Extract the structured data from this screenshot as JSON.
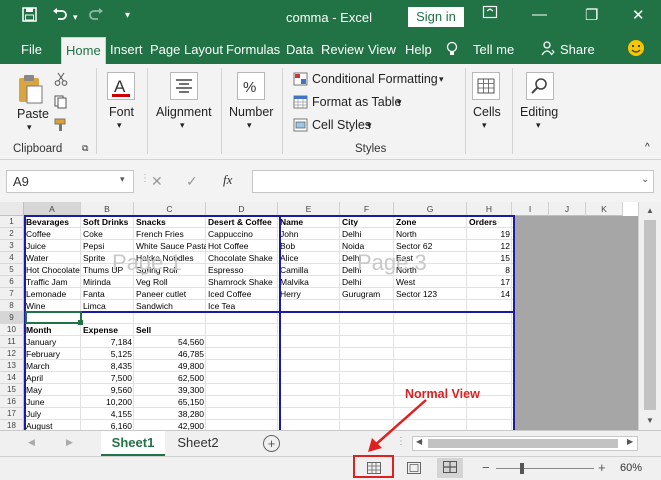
{
  "window": {
    "title": "comma  -  Excel",
    "signin_label": "Sign in",
    "minimize": "—",
    "restore": "❐",
    "close": "✕"
  },
  "tabs": [
    {
      "label": "File"
    },
    {
      "label": "Home"
    },
    {
      "label": "Insert"
    },
    {
      "label": "Page Layout"
    },
    {
      "label": "Formulas"
    },
    {
      "label": "Data"
    },
    {
      "label": "Review"
    },
    {
      "label": "View"
    },
    {
      "label": "Help"
    },
    {
      "label": "Tell me"
    },
    {
      "label": "Share"
    }
  ],
  "ribbon": {
    "paste": "Paste",
    "clipboard": "Clipboard",
    "font": "Font",
    "alignment": "Alignment",
    "number": "Number",
    "conditional_formatting": "Conditional Formatting",
    "format_as_table": "Format as Table",
    "cell_styles": "Cell Styles",
    "styles": "Styles",
    "cells": "Cells",
    "editing": "Editing"
  },
  "formula_bar": {
    "name_box": "A9",
    "fx": "fx",
    "cancel": "✕",
    "enter": "✓",
    "value": ""
  },
  "grid": {
    "columns": [
      "A",
      "B",
      "C",
      "D",
      "E",
      "F",
      "G",
      "H",
      "I",
      "J",
      "K"
    ],
    "rows": [
      "1",
      "2",
      "3",
      "4",
      "5",
      "6",
      "7",
      "8",
      "9",
      "10",
      "11",
      "12",
      "13",
      "14",
      "15",
      "16",
      "17",
      "18"
    ],
    "table1": [
      [
        "Bevarages",
        "Soft Drinks",
        "Snacks",
        "Desert & Coffee"
      ],
      [
        "Coffee",
        "Coke",
        "French Fries",
        "Cappuccino"
      ],
      [
        "Juice",
        "Pepsi",
        "White Sauce Pasta",
        "Hot Coffee"
      ],
      [
        "Water",
        "Sprite",
        "Hakka Noodles",
        "Chocolate Shake"
      ],
      [
        "Hot Chocolate",
        "Thums UP",
        "Spring Roll",
        "Espresso"
      ],
      [
        "Traffic Jam",
        "Mirinda",
        "Veg Roll",
        "Shamrock Shake"
      ],
      [
        "Lemonade",
        "Fanta",
        "Paneer cutlet",
        "Iced Coffee"
      ],
      [
        "Wine",
        "Limca",
        "Sandwich",
        "Ice Tea"
      ]
    ],
    "table2": [
      [
        "Name",
        "City",
        "Zone",
        "Orders"
      ],
      [
        "John",
        "Delhi",
        "North",
        "19"
      ],
      [
        "Bob",
        "Noida",
        "Sector 62",
        "12"
      ],
      [
        "Alice",
        "Delhi",
        "East",
        "15"
      ],
      [
        "Camilla",
        "Delhi",
        "North",
        "8"
      ],
      [
        "Malvika",
        "Delhi",
        "West",
        "17"
      ],
      [
        "Herry",
        "Gurugram",
        "Sector 123",
        "14"
      ]
    ],
    "table3_header": [
      "Month",
      "Expense",
      "Sell"
    ],
    "table3": [
      [
        "January",
        "7,184",
        "54,560"
      ],
      [
        "February",
        "5,125",
        "46,785"
      ],
      [
        "March",
        "8,435",
        "49,800"
      ],
      [
        "April",
        "7,500",
        "62,500"
      ],
      [
        "May",
        "9,560",
        "39,300"
      ],
      [
        "June",
        "10,200",
        "65,150"
      ],
      [
        "July",
        "4,155",
        "38,280"
      ],
      [
        "August",
        "6,160",
        "42,900"
      ]
    ],
    "watermark1": "Page 1",
    "watermark3": "Page 3"
  },
  "sheets": {
    "tabs": [
      "Sheet1",
      "Sheet2"
    ],
    "active": "Sheet1",
    "add": "+"
  },
  "status": {
    "zoom": "60%",
    "minus": "−",
    "plus": "+"
  },
  "annotation": "Normal View"
}
